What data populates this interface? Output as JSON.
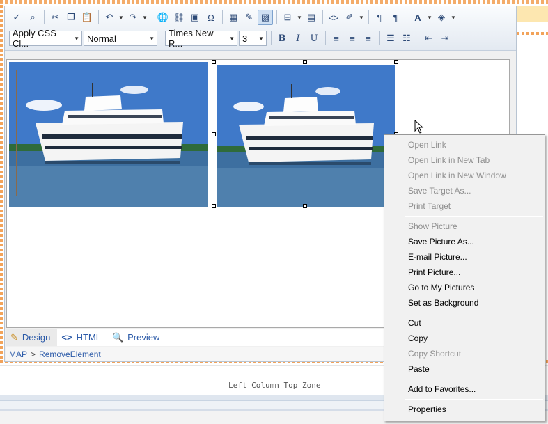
{
  "toolbar": {
    "css_class_value": "Apply CSS Cl...",
    "paragraph_value": "Normal",
    "font_value": "Times New R...",
    "size_value": "3",
    "bold_label": "B",
    "italic_label": "I",
    "underline_label": "U"
  },
  "tabs": {
    "design": "Design",
    "html": "HTML",
    "preview": "Preview"
  },
  "breadcrumb": {
    "item1": "MAP",
    "separator": ">",
    "item2": "RemoveElement"
  },
  "zone_label": "Left Column Top Zone",
  "context_menu": {
    "open_link": "Open Link",
    "open_link_new_tab": "Open Link in New Tab",
    "open_link_new_window": "Open Link in New Window",
    "save_target_as": "Save Target As...",
    "print_target": "Print Target",
    "show_picture": "Show Picture",
    "save_picture_as": "Save Picture As...",
    "email_picture": "E-mail Picture...",
    "print_picture": "Print Picture...",
    "go_to_my_pictures": "Go to My Pictures",
    "set_as_background": "Set as Background",
    "cut": "Cut",
    "copy": "Copy",
    "copy_shortcut": "Copy Shortcut",
    "paste": "Paste",
    "add_to_favorites": "Add to Favorites...",
    "properties": "Properties"
  },
  "colors": {
    "accent_link": "#2b5aa8",
    "dashed_border": "#f2a35a",
    "disabled_text": "#8d8d8d"
  }
}
